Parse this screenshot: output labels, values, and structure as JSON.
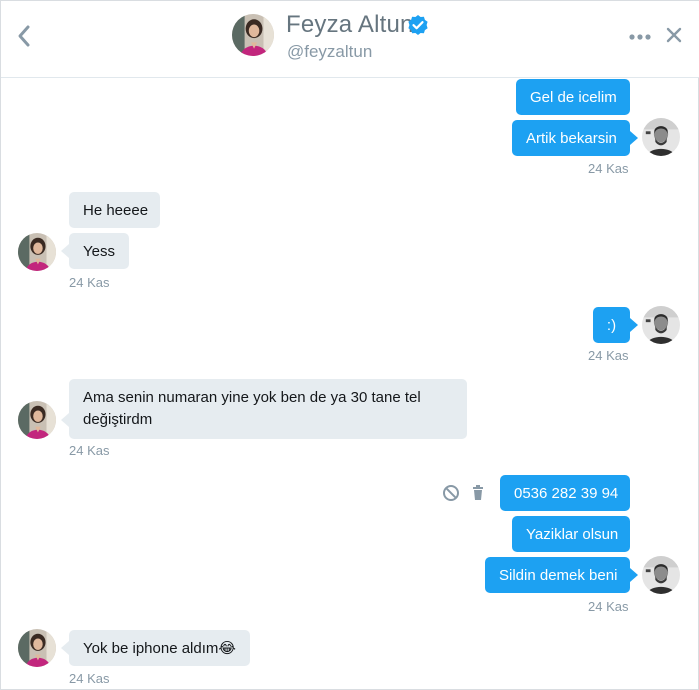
{
  "header": {
    "name": "Feyza Altun",
    "handle": "@feyzaltun",
    "back_icon": "chevron-left-icon",
    "verified_icon": "verified-badge-icon",
    "more_icon": "more-dots-icon",
    "close_icon": "close-icon"
  },
  "colors": {
    "outgoing_bubble": "#1da1f2",
    "incoming_bubble": "#e6ecf0",
    "muted_text": "#8899a6"
  },
  "messages": {
    "g1": {
      "m1": "Gel de icelim",
      "m2": "Artik bekarsin",
      "time": "24 Kas"
    },
    "g2": {
      "m1": "He heeee",
      "m2": "Yess",
      "time": "24 Kas"
    },
    "g3": {
      "m1": ":)",
      "time": "24 Kas"
    },
    "g4": {
      "line1": "Ama senin numaran yine yok ben de ya 30 tane tel",
      "line2": "değiştirdm",
      "time": "24 Kas"
    },
    "g5": {
      "m1": "0536 282 39 94",
      "m2": "Yaziklar olsun",
      "m3": "Sildin demek beni",
      "time": "24 Kas"
    },
    "g6": {
      "m1": "Yok be iphone aldım",
      "emoji": "😂",
      "time": "24 Kas"
    }
  },
  "actions": {
    "block_icon": "block-icon",
    "delete_icon": "trash-icon"
  }
}
